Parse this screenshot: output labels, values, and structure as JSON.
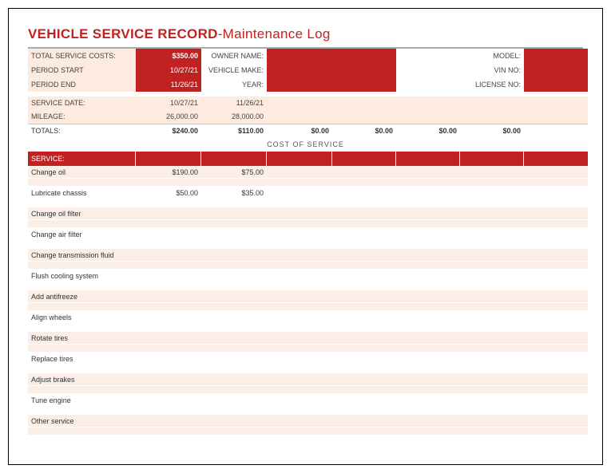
{
  "title_strong": "VEHICLE SERVICE RECORD",
  "title_rest": "-Maintenance Log",
  "header": {
    "total_costs_label": "TOTAL SERVICE COSTS:",
    "total_costs_value": "$350.00",
    "period_start_label": "PERIOD START",
    "period_start_value": "10/27/21",
    "period_end_label": "PERIOD END",
    "period_end_value": "11/26/21",
    "owner_name_label": "OWNER NAME:",
    "owner_name_value": "",
    "vehicle_make_label": "VEHICLE MAKE:",
    "vehicle_make_value": "",
    "year_label": "YEAR:",
    "year_value": "",
    "model_label": "MODEL:",
    "model_value": "",
    "vin_label": "VIN NO:",
    "vin_value": "",
    "license_label": "LICENSE NO:",
    "license_value": ""
  },
  "summary": {
    "service_date_label": "SERVICE DATE:",
    "mileage_label": "MILEAGE:",
    "totals_label": "TOTALS:",
    "cost_of_service_label": "COST OF SERVICE",
    "columns": [
      {
        "date": "10/27/21",
        "mileage": "26,000.00",
        "total": "$240.00"
      },
      {
        "date": "11/26/21",
        "mileage": "28,000.00",
        "total": "$110.00"
      },
      {
        "date": "",
        "mileage": "",
        "total": "$0.00"
      },
      {
        "date": "",
        "mileage": "",
        "total": "$0.00"
      },
      {
        "date": "",
        "mileage": "",
        "total": "$0.00"
      },
      {
        "date": "",
        "mileage": "",
        "total": "$0.00"
      }
    ]
  },
  "service_header_label": "SERVICE:",
  "services": [
    {
      "label": "Change oil",
      "values": [
        "$190.00",
        "$75.00",
        "",
        "",
        "",
        ""
      ]
    },
    {
      "label": "Lubricate chassis",
      "values": [
        "$50.00",
        "$35.00",
        "",
        "",
        "",
        ""
      ]
    },
    {
      "label": "Change oil filter",
      "values": [
        "",
        "",
        "",
        "",
        "",
        ""
      ]
    },
    {
      "label": "Change air filter",
      "values": [
        "",
        "",
        "",
        "",
        "",
        ""
      ]
    },
    {
      "label": "Change transmission fluid",
      "values": [
        "",
        "",
        "",
        "",
        "",
        ""
      ]
    },
    {
      "label": "Flush cooling system",
      "values": [
        "",
        "",
        "",
        "",
        "",
        ""
      ]
    },
    {
      "label": "Add antifreeze",
      "values": [
        "",
        "",
        "",
        "",
        "",
        ""
      ]
    },
    {
      "label": "Align wheels",
      "values": [
        "",
        "",
        "",
        "",
        "",
        ""
      ]
    },
    {
      "label": "Rotate tires",
      "values": [
        "",
        "",
        "",
        "",
        "",
        ""
      ]
    },
    {
      "label": "Replace tires",
      "values": [
        "",
        "",
        "",
        "",
        "",
        ""
      ]
    },
    {
      "label": "Adjust brakes",
      "values": [
        "",
        "",
        "",
        "",
        "",
        ""
      ]
    },
    {
      "label": "Tune engine",
      "values": [
        "",
        "",
        "",
        "",
        "",
        ""
      ]
    },
    {
      "label": "Other service",
      "values": [
        "",
        "",
        "",
        "",
        "",
        ""
      ]
    }
  ],
  "chart_data": {
    "type": "table",
    "title": "VEHICLE SERVICE RECORD - Maintenance Log",
    "header_info": {
      "total_service_costs": 350.0,
      "period_start": "10/27/21",
      "period_end": "11/26/21"
    },
    "columns": [
      "10/27/21",
      "11/26/21",
      "",
      "",
      "",
      ""
    ],
    "mileage": [
      26000,
      28000,
      null,
      null,
      null,
      null
    ],
    "totals": [
      240.0,
      110.0,
      0.0,
      0.0,
      0.0,
      0.0
    ],
    "rows": [
      {
        "service": "Change oil",
        "costs": [
          190.0,
          75.0,
          null,
          null,
          null,
          null
        ]
      },
      {
        "service": "Lubricate chassis",
        "costs": [
          50.0,
          35.0,
          null,
          null,
          null,
          null
        ]
      },
      {
        "service": "Change oil filter",
        "costs": [
          null,
          null,
          null,
          null,
          null,
          null
        ]
      },
      {
        "service": "Change air filter",
        "costs": [
          null,
          null,
          null,
          null,
          null,
          null
        ]
      },
      {
        "service": "Change transmission fluid",
        "costs": [
          null,
          null,
          null,
          null,
          null,
          null
        ]
      },
      {
        "service": "Flush cooling system",
        "costs": [
          null,
          null,
          null,
          null,
          null,
          null
        ]
      },
      {
        "service": "Add antifreeze",
        "costs": [
          null,
          null,
          null,
          null,
          null,
          null
        ]
      },
      {
        "service": "Align wheels",
        "costs": [
          null,
          null,
          null,
          null,
          null,
          null
        ]
      },
      {
        "service": "Rotate tires",
        "costs": [
          null,
          null,
          null,
          null,
          null,
          null
        ]
      },
      {
        "service": "Replace tires",
        "costs": [
          null,
          null,
          null,
          null,
          null,
          null
        ]
      },
      {
        "service": "Adjust brakes",
        "costs": [
          null,
          null,
          null,
          null,
          null,
          null
        ]
      },
      {
        "service": "Tune engine",
        "costs": [
          null,
          null,
          null,
          null,
          null,
          null
        ]
      },
      {
        "service": "Other service",
        "costs": [
          null,
          null,
          null,
          null,
          null,
          null
        ]
      }
    ]
  }
}
